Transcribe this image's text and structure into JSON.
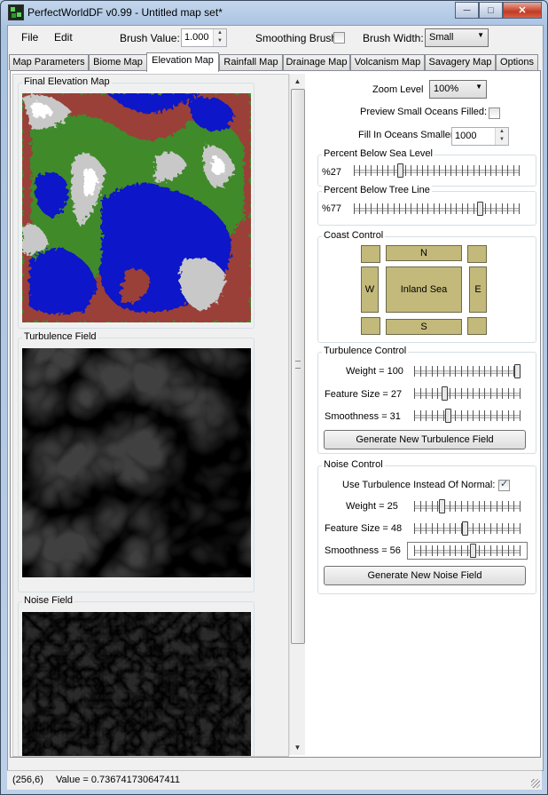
{
  "window": {
    "title": "PerfectWorldDF v0.99 - Untitled map set*",
    "minimize": "─",
    "maximize": "□",
    "close": "✕"
  },
  "menubar": {
    "file": "File",
    "edit": "Edit",
    "brush_value_label": "Brush Value:",
    "brush_value": "1.000",
    "smoothing_brush_label": "Smoothing Brush",
    "smoothing_brush_checked": false,
    "brush_width_label": "Brush Width:",
    "brush_width_value": "Small"
  },
  "tabs": [
    {
      "label": "Map Parameters",
      "active": false
    },
    {
      "label": "Biome Map",
      "active": false
    },
    {
      "label": "Elevation Map",
      "active": true
    },
    {
      "label": "Rainfall Map",
      "active": false
    },
    {
      "label": "Drainage Map",
      "active": false
    },
    {
      "label": "Volcanism Map",
      "active": false
    },
    {
      "label": "Savagery Map",
      "active": false
    },
    {
      "label": "Options",
      "active": false
    }
  ],
  "left": {
    "final_elevation_title": "Final Elevation Map",
    "turbulence_field_title": "Turbulence Field",
    "noise_field_title": "Noise Field"
  },
  "right": {
    "zoom_label": "Zoom Level",
    "zoom_value": "100%",
    "preview_oceans_label": "Preview Small Oceans Filled:",
    "preview_oceans_checked": false,
    "fill_oceans_label": "Fill In Oceans Smaller Than:",
    "fill_oceans_value": "1000",
    "sea_level": {
      "title": "Percent Below Sea Level",
      "value_text": "%27",
      "value": 27
    },
    "tree_line": {
      "title": "Percent Below Tree Line",
      "value_text": "%77",
      "value": 77
    },
    "coast": {
      "title": "Coast Control",
      "north": "N",
      "south": "S",
      "west": "W",
      "east": "E",
      "center": "Inland Sea"
    },
    "turbulence": {
      "title": "Turbulence Control",
      "weight_label": "Weight = 100",
      "weight": 100,
      "feature_size_label": "Feature Size = 27",
      "feature_size": 27,
      "smoothness_label": "Smoothness = 31",
      "smoothness": 31,
      "generate_label": "Generate New Turbulence Field"
    },
    "noise": {
      "title": "Noise Control",
      "use_turbulence_label": "Use Turbulence Instead Of Normal:",
      "use_turbulence_checked": true,
      "weight_label": "Weight = 25",
      "weight": 25,
      "feature_size_label": "Feature Size = 48",
      "feature_size": 48,
      "smoothness_label": "Smoothness = 56",
      "smoothness": 56,
      "generate_label": "Generate New Noise Field"
    }
  },
  "status": {
    "coords": "(256,6)",
    "value_text": "Value = 0.736741730647411"
  },
  "colors": {
    "ocean": "#0b12c8",
    "lowland": "#3f8a2a",
    "midland": "#9a4038",
    "highland": "#c8c8c8",
    "peak": "#ffffff",
    "pad": "#c3b97a"
  }
}
